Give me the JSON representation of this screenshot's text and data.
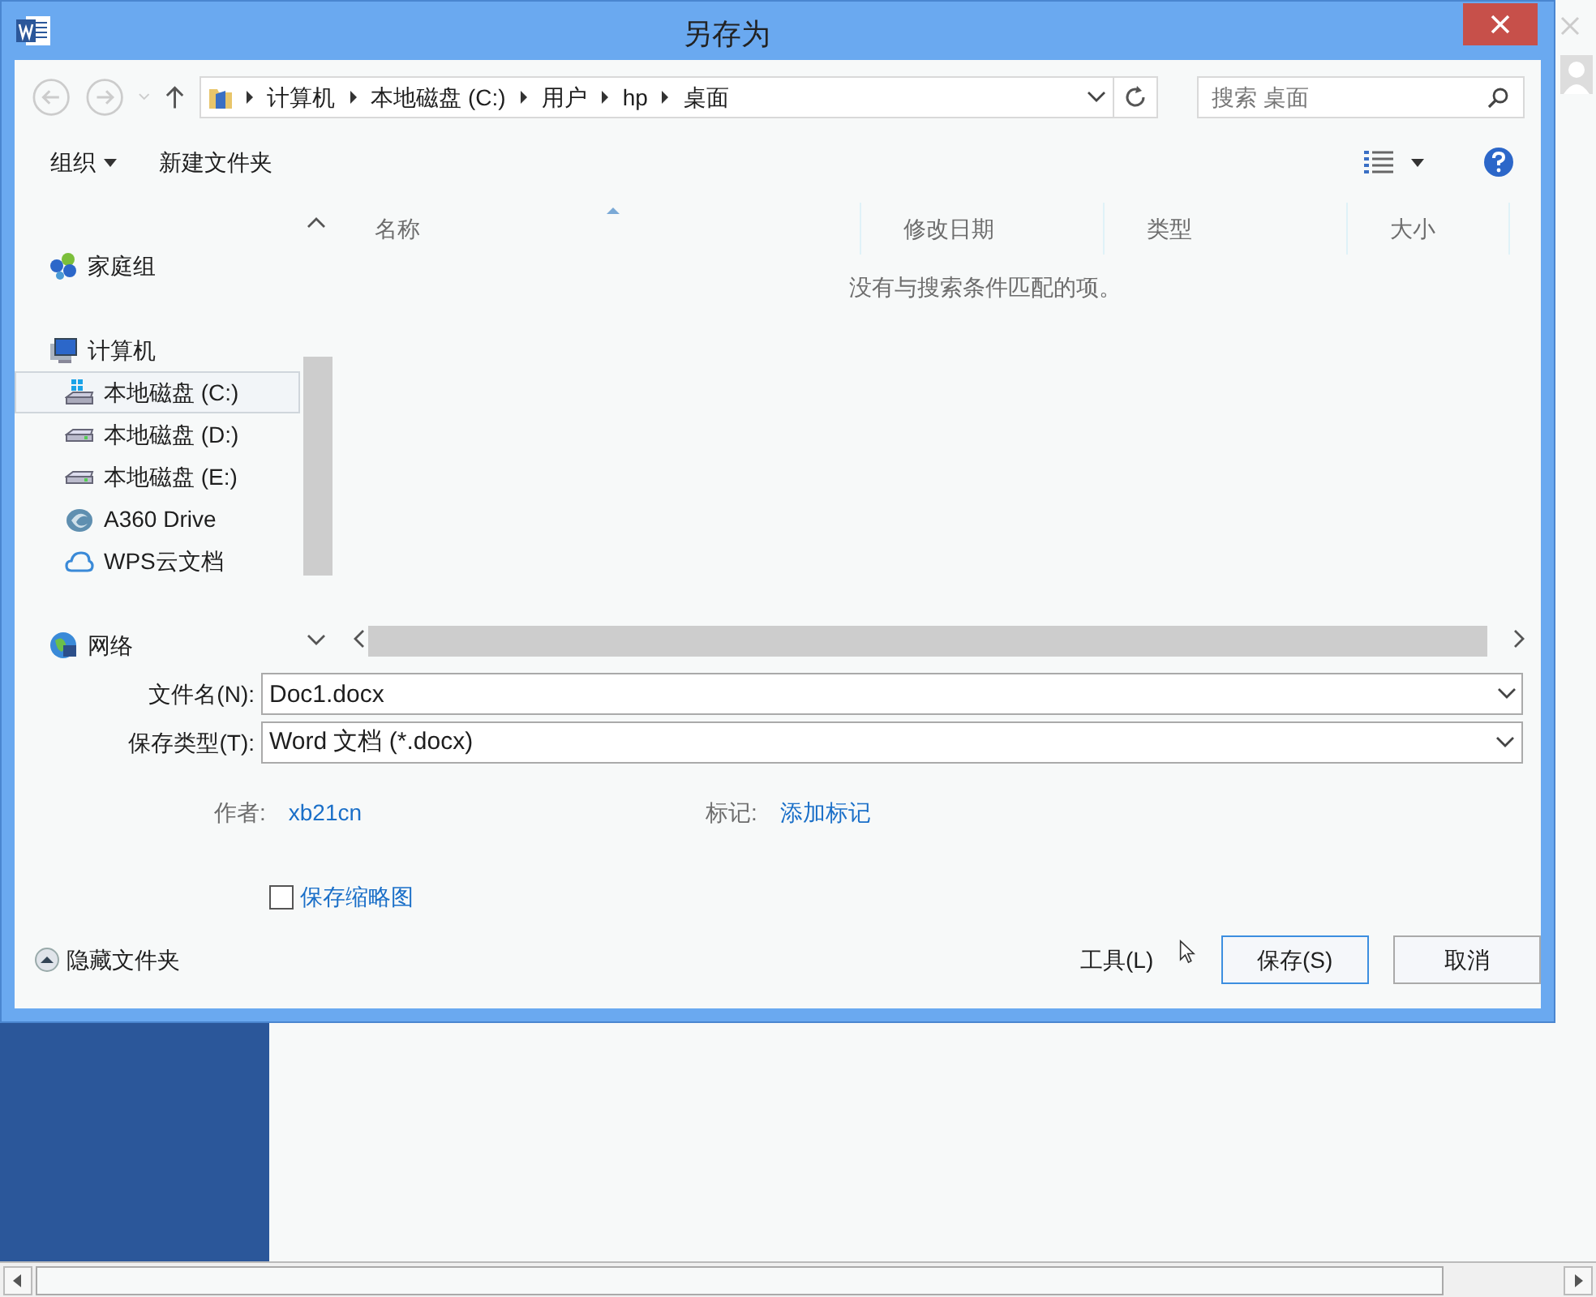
{
  "window": {
    "title": "另存为"
  },
  "address": {
    "path": [
      "计算机",
      "本地磁盘 (C:)",
      "用户",
      "hp",
      "桌面"
    ]
  },
  "search": {
    "placeholder": "搜索 桌面"
  },
  "toolbar": {
    "organize": "组织",
    "new_folder": "新建文件夹"
  },
  "sidebar": {
    "items": [
      {
        "label": "家庭组",
        "kind": "homegroup",
        "selected": false
      },
      {
        "label": "计算机",
        "kind": "computer",
        "selected": false,
        "children": [
          {
            "label": "本地磁盘 (C:)",
            "kind": "system_drive",
            "selected": true
          },
          {
            "label": "本地磁盘 (D:)",
            "kind": "drive",
            "selected": false
          },
          {
            "label": "本地磁盘 (E:)",
            "kind": "drive",
            "selected": false
          },
          {
            "label": "A360 Drive",
            "kind": "a360",
            "selected": false
          },
          {
            "label": "WPS云文档",
            "kind": "cloud",
            "selected": false
          }
        ]
      },
      {
        "label": "网络",
        "kind": "network",
        "selected": false
      }
    ]
  },
  "file_list": {
    "columns": [
      "名称",
      "修改日期",
      "类型",
      "大小"
    ],
    "empty_message": "没有与搜索条件匹配的项。"
  },
  "form": {
    "file_name_label": "文件名(N):",
    "file_name": "Doc1.docx",
    "type_label": "保存类型(T):",
    "type": "Word 文档 (*.docx)",
    "author_label": "作者:",
    "author": "xb21cn",
    "tags_label": "标记:",
    "tags": "添加标记",
    "thumbnail": {
      "label": "保存缩略图",
      "checked": false
    }
  },
  "footer": {
    "hide_folders": "隐藏文件夹",
    "tools": "工具(L)",
    "save": "保存(S)",
    "cancel": "取消"
  }
}
